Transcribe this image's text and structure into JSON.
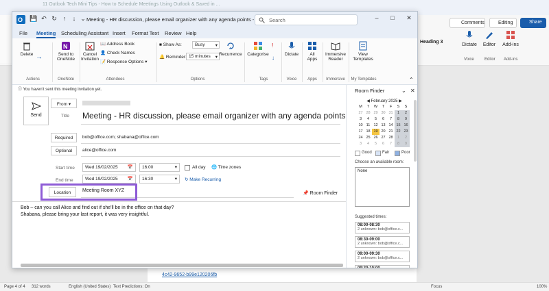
{
  "outlook": {
    "title": "Meeting - HR discussion, please email organizer with any agenda points - Me...",
    "search_placeholder": "Search",
    "tabs": [
      "File",
      "Meeting",
      "Scheduling Assistant",
      "Insert",
      "Format Text",
      "Review",
      "Help"
    ],
    "active_tab": "Meeting",
    "ribbon": {
      "delete": "Delete",
      "actions_group": "Actions",
      "send_to_onenote": "Send to\nOneNote",
      "onenote_group": "OneNote",
      "cancel_invitation": "Cancel\nInvitation",
      "address_book": "Address Book",
      "check_names": "Check Names",
      "response_options": "Response Options",
      "attendees_group": "Attendees",
      "show_as_label": "Show As:",
      "show_as_value": "Busy",
      "reminder_label": "Reminder:",
      "reminder_value": "15 minutes",
      "recurrence": "Recurrence",
      "options_group": "Options",
      "categorise": "Categorise",
      "tags_group": "Tags",
      "dictate": "Dictate",
      "voice_group": "Voice",
      "all_apps": "All\nApps",
      "apps_group": "Apps",
      "immersive_reader": "Immersive\nReader",
      "immersive_group": "Immersive",
      "view_templates": "View\nTemplates",
      "templates_group": "My Templates"
    },
    "info_bar": "You haven't sent this meeting invitation yet.",
    "send_label": "Send",
    "from_label": "From",
    "title_label": "Title",
    "meeting_title": "Meeting - HR discussion, please email organizer with any agenda points",
    "required_label": "Required",
    "required_value": "bob@office.com; shabana@office.com",
    "optional_label": "Optional",
    "optional_value": "alice@office.com",
    "start_label": "Start time",
    "start_date": "Wed 19/02/2025",
    "start_time": "16:00",
    "end_label": "End time",
    "end_date": "Wed 19/02/2025",
    "end_time": "16:30",
    "all_day": "All day",
    "time_zones": "Time zones",
    "make_recurring": "Make Recurring",
    "location_label": "Location",
    "location_value": "Meeting Room XYZ",
    "room_finder_link": "Room Finder",
    "message_line1": "Bob – can you call Alice and find out if she'll be in the office on that day?",
    "message_line2": "Shabana, please bring your last report, it was very insightful."
  },
  "room_finder": {
    "title": "Room Finder",
    "month": "February 2025",
    "weekdays": [
      "M",
      "T",
      "W",
      "T",
      "F",
      "S",
      "S"
    ],
    "weeks": [
      [
        "27",
        "28",
        "29",
        "30",
        "31",
        "1",
        "2"
      ],
      [
        "3",
        "4",
        "5",
        "6",
        "7",
        "8",
        "9"
      ],
      [
        "10",
        "11",
        "12",
        "13",
        "14",
        "15",
        "16"
      ],
      [
        "17",
        "18",
        "19",
        "20",
        "21",
        "22",
        "23"
      ],
      [
        "24",
        "25",
        "26",
        "27",
        "28",
        "1",
        "2"
      ],
      [
        "3",
        "4",
        "5",
        "6",
        "7",
        "8",
        "9"
      ]
    ],
    "today": "19",
    "legend": [
      "Good",
      "Fair",
      "Poor"
    ],
    "choose_room_label": "Choose an available room:",
    "room_list": [
      "None"
    ],
    "suggested_label": "Suggested times:",
    "suggestions": [
      {
        "time": "08:00-08:30",
        "sub": "2 unknown: bob@office.c..."
      },
      {
        "time": "08:30-09:00",
        "sub": "2 unknown: bob@office.c..."
      },
      {
        "time": "09:00-09:30",
        "sub": "2 unknown: bob@office.c..."
      },
      {
        "time": "09:30-10:00",
        "sub": "2 unknown: bob@office.c..."
      },
      {
        "time": "10:00-10:30",
        "sub": "2 unknown: bob@office.c..."
      },
      {
        "time": "10:30-11:00",
        "sub": "2 unknown: bob@office.c..."
      }
    ]
  },
  "word": {
    "tab_text": "11 Outlook Tech Mini Tips - How to Schedule Meetings Using Outlook & Saved in ...",
    "comments": "Comments",
    "editing": "Editing",
    "share": "Share",
    "heading3": "Heading 3",
    "dictate": "Dictate",
    "editor": "Editor",
    "addins": "Add-ins",
    "voice_group": "Voice",
    "editor_group": "Editor",
    "addins_group": "Add-ins",
    "doc_link": "4c42-9652-b99e120206fb",
    "status": {
      "page": "Page 4 of 4",
      "words": "312 words",
      "language": "English (United States)",
      "text_predictions": "Text Predictions: On",
      "focus": "Focus",
      "zoom": "100%"
    }
  },
  "colors": {
    "accent": "#1a5dab",
    "highlight": "#8e5bd6",
    "today": "#f4c542"
  }
}
